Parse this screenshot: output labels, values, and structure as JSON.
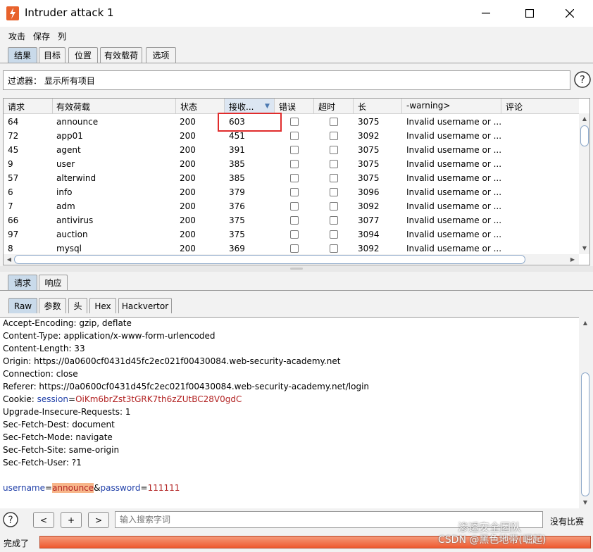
{
  "window": {
    "title": "Intruder attack 1"
  },
  "menu": [
    "攻击",
    "保存",
    "列"
  ],
  "main_tabs": [
    "结果",
    "目标",
    "位置",
    "有效载荷",
    "选项"
  ],
  "filter": {
    "text": "过滤器： 显示所有项目"
  },
  "table": {
    "columns": [
      "请求",
      "有效荷载",
      "状态",
      "接收...",
      "错误",
      "超时",
      "长",
      "-warning>",
      "评论"
    ],
    "rows": [
      {
        "req": "64",
        "payload": "announce",
        "status": "200",
        "recv": "603",
        "len": "3075",
        "warning": "Invalid username or ..."
      },
      {
        "req": "72",
        "payload": "app01",
        "status": "200",
        "recv": "451",
        "len": "3092",
        "warning": "Invalid username or ..."
      },
      {
        "req": "45",
        "payload": "agent",
        "status": "200",
        "recv": "391",
        "len": "3075",
        "warning": "Invalid username or ..."
      },
      {
        "req": "9",
        "payload": "user",
        "status": "200",
        "recv": "385",
        "len": "3075",
        "warning": "Invalid username or ..."
      },
      {
        "req": "57",
        "payload": "alterwind",
        "status": "200",
        "recv": "385",
        "len": "3075",
        "warning": "Invalid username or ..."
      },
      {
        "req": "6",
        "payload": "info",
        "status": "200",
        "recv": "379",
        "len": "3096",
        "warning": "Invalid username or ..."
      },
      {
        "req": "7",
        "payload": "adm",
        "status": "200",
        "recv": "376",
        "len": "3092",
        "warning": "Invalid username or ..."
      },
      {
        "req": "66",
        "payload": "antivirus",
        "status": "200",
        "recv": "375",
        "len": "3077",
        "warning": "Invalid username or ..."
      },
      {
        "req": "97",
        "payload": "auction",
        "status": "200",
        "recv": "375",
        "len": "3094",
        "warning": "Invalid username or ..."
      },
      {
        "req": "8",
        "payload": "mysql",
        "status": "200",
        "recv": "369",
        "len": "3092",
        "warning": "Invalid username or ..."
      }
    ]
  },
  "detail_tabs": [
    "请求",
    "响应"
  ],
  "view_tabs": [
    "Raw",
    "参数",
    "头",
    "Hex",
    "Hackvertor"
  ],
  "request": {
    "lines": [
      "Accept-Encoding: gzip, deflate",
      "Content-Type: application/x-www-form-urlencoded",
      "Content-Length: 33",
      "Origin: https://0a0600cf0431d45fc2ec021f00430084.web-security-academy.net",
      "Connection: close",
      "Referer: https://0a0600cf0431d45fc2ec021f00430084.web-security-academy.net/login"
    ],
    "cookie_label": "Cookie: ",
    "cookie_name": "session",
    "cookie_value": "OiKm6brZst3tGRK7th6zZUtBC28V0gdC",
    "lines2": [
      "Upgrade-Insecure-Requests: 1",
      "Sec-Fetch-Dest: document",
      "Sec-Fetch-Mode: navigate",
      "Sec-Fetch-Site: same-origin",
      "Sec-Fetch-User: ?1"
    ],
    "body": {
      "user_key": "username",
      "user_value": "announce",
      "amp": "&",
      "pass_key": "password",
      "pass_value": "111111"
    }
  },
  "search": {
    "prev": "<",
    "add": "+",
    "next": ">",
    "placeholder": "输入搜索字词",
    "no_match": "没有比赛"
  },
  "status": {
    "text": "完成了",
    "progress": 1.0
  },
  "watermark": {
    "line1": "渗透安全团队",
    "line2": "CSDN @黑色地带(崛起)"
  },
  "colors": {
    "tab_active": "#c9daea",
    "highlight_border": "#e02c2c",
    "progress": "#f0643c",
    "payload_highlight": "#f7b68a"
  }
}
